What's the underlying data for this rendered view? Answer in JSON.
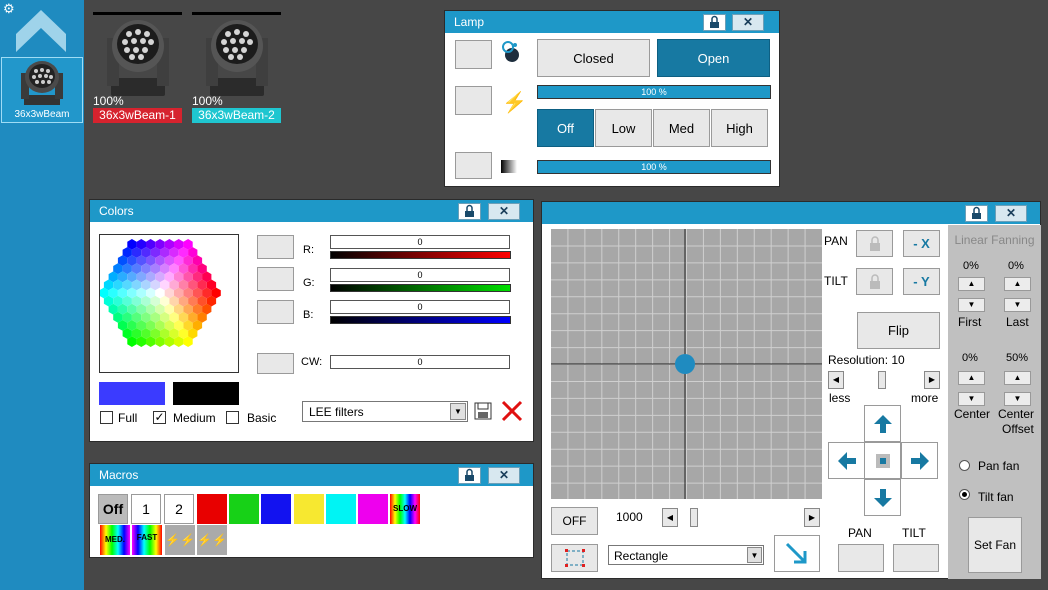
{
  "sidebar": {
    "device_label": "36x3wBeam"
  },
  "fixtures": [
    {
      "percent": "100%",
      "name": "36x3wBeam-1",
      "color": "#d6232e"
    },
    {
      "percent": "100%",
      "name": "36x3wBeam-2",
      "color": "#1fc6d0"
    }
  ],
  "lamp": {
    "title": "Lamp",
    "closed": "Closed",
    "open": "Open",
    "bar1": "100 %",
    "bar1_level": 1.0,
    "bar2": "100 %",
    "bar2_level": 1.0,
    "power": [
      "Off",
      "Low",
      "Med",
      "High"
    ]
  },
  "colors": {
    "title": "Colors",
    "r_label": "R:",
    "g_label": "G:",
    "b_label": "B:",
    "cw_label": "CW:",
    "r_value": "0",
    "g_value": "0",
    "b_value": "0",
    "cw_value": "0",
    "full": "Full",
    "medium": "Medium",
    "basic": "Basic",
    "filter": "LEE filters",
    "swatch1": "#3b3bff",
    "swatch2": "#000000"
  },
  "macros": {
    "title": "Macros",
    "off": "Off",
    "one": "1",
    "two": "2",
    "slow": "SLOW",
    "med": "MED.",
    "fast": "FAST",
    "swatches": [
      "#e80000",
      "#17d117",
      "#1212f0",
      "#f7e830",
      "#00f4f4",
      "#ee00ee"
    ]
  },
  "pantilt": {
    "pan": "PAN",
    "tilt": "TILT",
    "minus_x": "- X",
    "minus_y": "- Y",
    "flip": "Flip",
    "resolution": "Resolution: 10",
    "less": "less",
    "more": "more",
    "off": "OFF",
    "value": "1000",
    "shape": "Rectangle",
    "pan_bottom": "PAN",
    "tilt_bottom": "TILT",
    "linear_fanning": "Linear Fanning",
    "first_pct": "0%",
    "last_pct": "0%",
    "first": "First",
    "last": "Last",
    "center_pct": "0%",
    "offset_pct": "50%",
    "center": "Center",
    "center_offset1": "Center",
    "center_offset2": "Offset",
    "pan_fan": "Pan fan",
    "tilt_fan": "Tilt fan",
    "set_fan": "Set Fan"
  }
}
